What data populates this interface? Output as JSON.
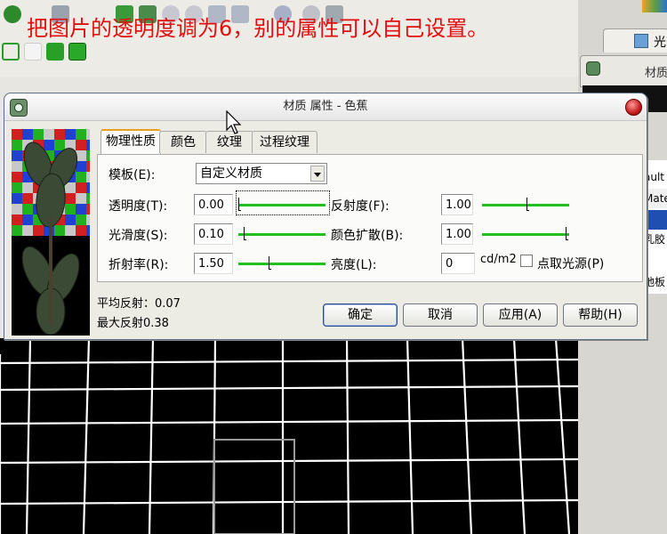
{
  "annotation": "把图片的透明度调为6，别的属性可以自己设置。",
  "dialog": {
    "title": "材质 属性 - 色蕉",
    "tabs": [
      "物理性质",
      "颜色",
      "纹理",
      "过程纹理"
    ],
    "active_tab": 0,
    "template": {
      "label": "模板(E):",
      "value": "自定义材质"
    },
    "fields": {
      "transparency": {
        "label": "透明度(T):",
        "value": "0.00",
        "level": 0.0
      },
      "smoothness": {
        "label": "光滑度(S):",
        "value": "0.10",
        "level": 0.06
      },
      "refraction": {
        "label": "折射率(R):",
        "value": "1.50",
        "level": 0.36
      },
      "reflectance": {
        "label": "反射度(F):",
        "value": "1.00",
        "level": 0.53
      },
      "color_bleed": {
        "label": "颜色扩散(B):",
        "value": "1.00",
        "level": 1.0
      },
      "luminance": {
        "label": "亮度(L):",
        "value": "0",
        "unit": "cd/m2"
      }
    },
    "pick_light": {
      "label": "点取光源(P)",
      "checked": false
    },
    "stats": {
      "avg_reflect": "平均反射：0.07",
      "max_reflect": "最大反射0.38"
    },
    "buttons": {
      "ok": "确定",
      "cancel": "取消",
      "apply": "应用(A)",
      "help": "帮助(H)"
    }
  },
  "right_panel": {
    "tab_label": "光",
    "panel_label": "材质",
    "list_items": [
      "ault",
      "Mate",
      "乳胶",
      "地板"
    ]
  },
  "colors": {
    "annotation": "#e01010",
    "slider_track": "#1fc01f",
    "tab_highlight": "#e8a020"
  }
}
